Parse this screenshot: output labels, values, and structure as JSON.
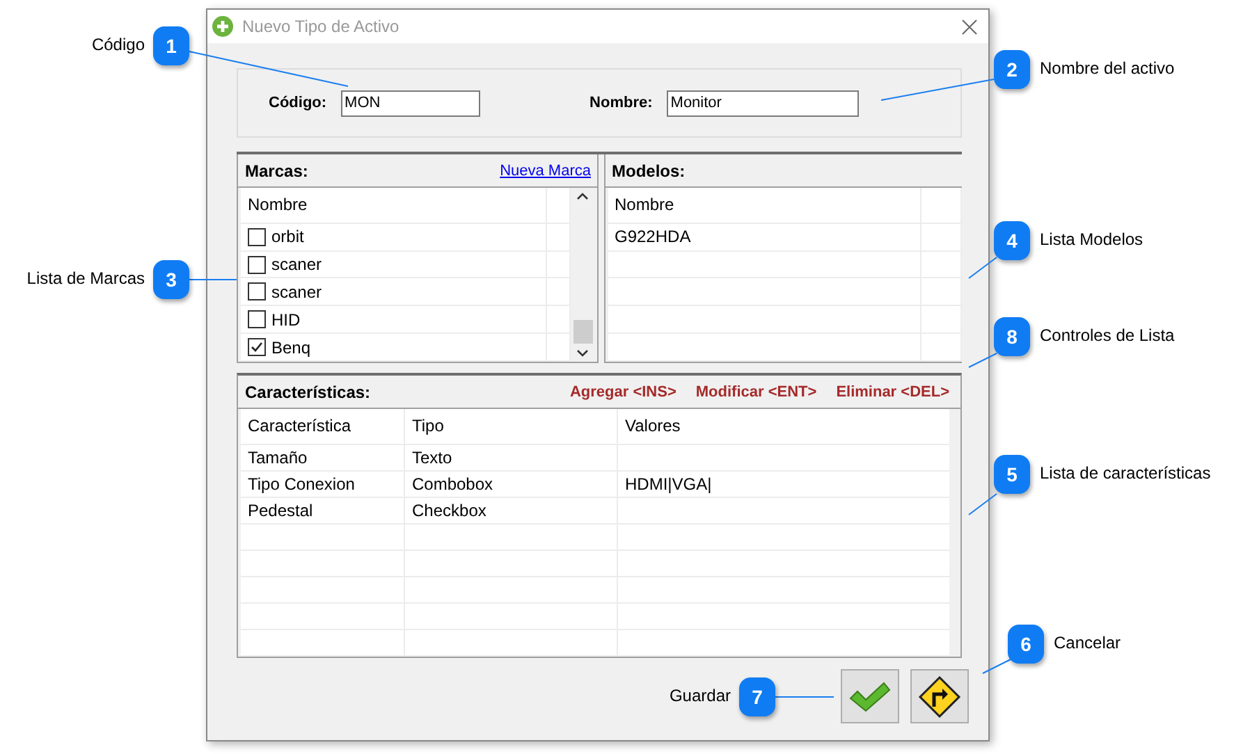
{
  "window": {
    "title": "Nuevo Tipo de Activo"
  },
  "header_fields": [
    {
      "label": "Código:",
      "value": "MON"
    },
    {
      "label": "Nombre:",
      "value": "Monitor"
    }
  ],
  "marcas": {
    "title": "Marcas:",
    "link": "Nueva Marca",
    "column": "Nombre",
    "rows": [
      {
        "name": "orbit",
        "checked": false
      },
      {
        "name": "scaner",
        "checked": false
      },
      {
        "name": "scaner",
        "checked": false
      },
      {
        "name": "HID",
        "checked": false
      },
      {
        "name": "Benq",
        "checked": true
      }
    ]
  },
  "modelos": {
    "title": "Modelos:",
    "column": "Nombre",
    "rows": [
      "G922HDA"
    ]
  },
  "caracteristicas": {
    "title": "Características:",
    "actions": [
      "Agregar <INS>",
      "Modificar <ENT>",
      "Eliminar <DEL>"
    ],
    "columns": [
      "Característica",
      "Tipo",
      "Valores"
    ],
    "rows": [
      [
        "Tamaño",
        "Texto",
        ""
      ],
      [
        "Tipo Conexion",
        "Combobox",
        "HDMI|VGA|"
      ],
      [
        "Pedestal",
        "Checkbox",
        ""
      ]
    ]
  },
  "buttons": [
    {
      "kind": "save"
    },
    {
      "kind": "cancel"
    }
  ],
  "callouts": [
    {
      "number": "1",
      "label": "Código"
    },
    {
      "number": "2",
      "label": "Nombre del activo"
    },
    {
      "number": "3",
      "label": "Lista de Marcas"
    },
    {
      "number": "4",
      "label": "Lista Modelos"
    },
    {
      "number": "8",
      "label": "Controles de Lista"
    },
    {
      "number": "5",
      "label": "Lista de características"
    },
    {
      "number": "6",
      "label": "Cancelar"
    },
    {
      "number": "7",
      "label": "Guardar"
    }
  ]
}
